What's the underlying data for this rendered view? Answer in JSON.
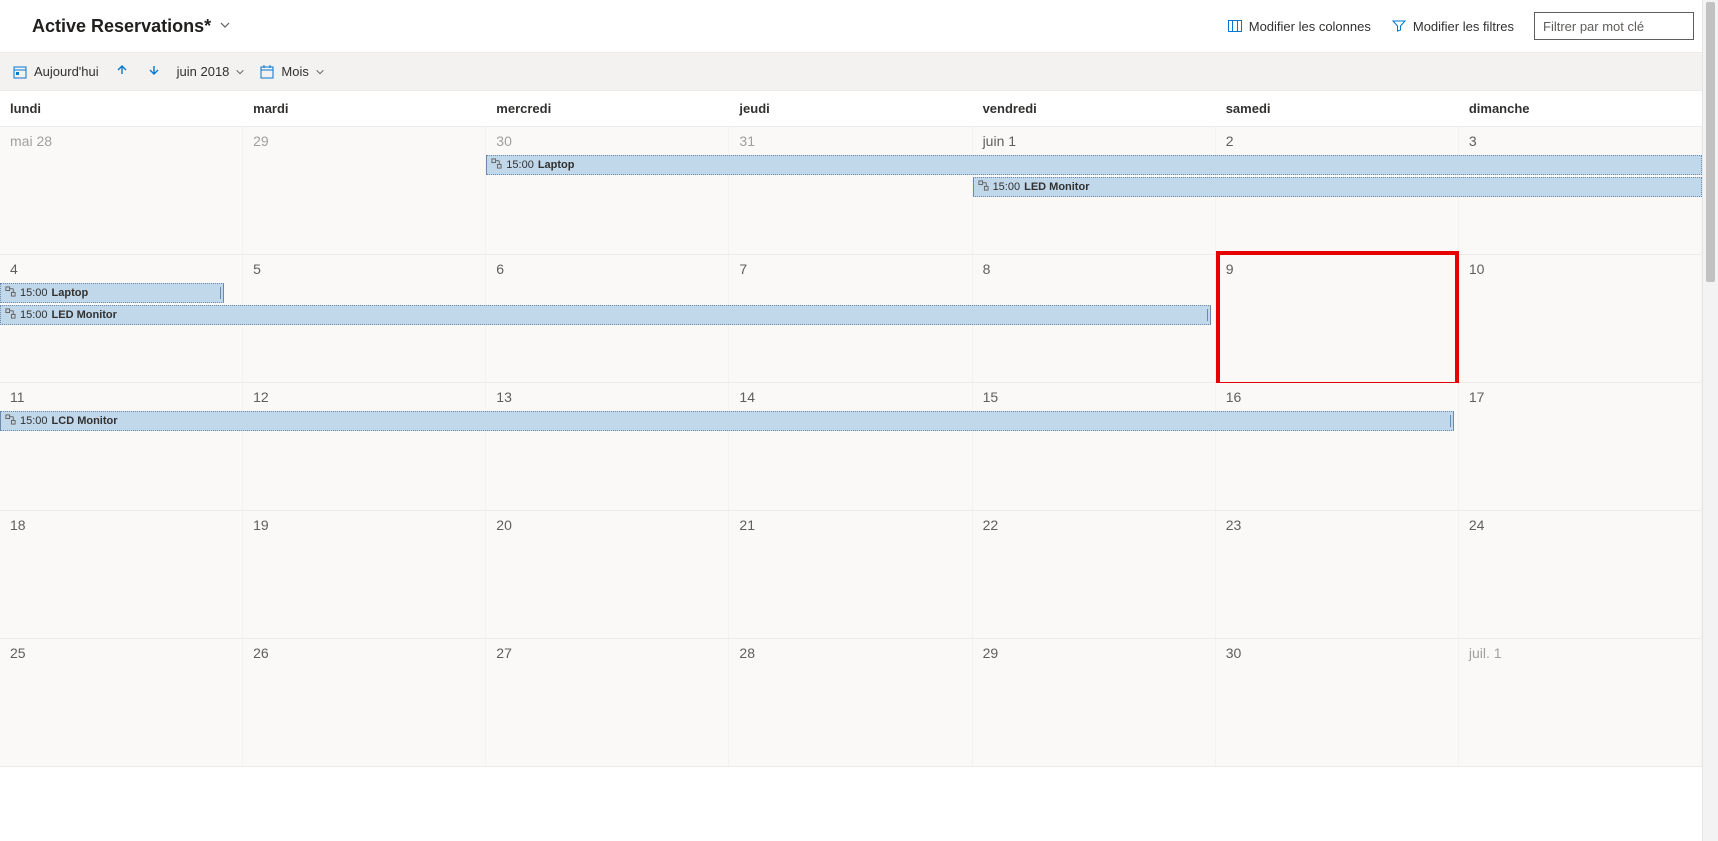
{
  "header": {
    "title": "Active Reservations*",
    "modify_columns": "Modifier les colonnes",
    "modify_filters": "Modifier les filtres",
    "filter_placeholder": "Filtrer par mot clé"
  },
  "toolbar": {
    "today": "Aujourd'hui",
    "date_label": "juin 2018",
    "view_label": "Mois"
  },
  "days": [
    "lundi",
    "mardi",
    "mercredi",
    "jeudi",
    "vendredi",
    "samedi",
    "dimanche"
  ],
  "weeks": [
    {
      "cells": [
        {
          "label": "mai 28",
          "other": true
        },
        {
          "label": "29",
          "other": true
        },
        {
          "label": "30",
          "other": true
        },
        {
          "label": "31",
          "other": true
        },
        {
          "label": "juin 1"
        },
        {
          "label": "2"
        },
        {
          "label": "3"
        }
      ],
      "events": [
        {
          "row": 0,
          "startCol": 2,
          "endCol": 7,
          "time": "15:00",
          "title": "Laptop",
          "startCap": true,
          "endCap": false
        },
        {
          "row": 1,
          "startCol": 4,
          "endCol": 7,
          "time": "15:00",
          "title": "LED Monitor",
          "startCap": true,
          "endCap": false
        }
      ]
    },
    {
      "cells": [
        {
          "label": "4"
        },
        {
          "label": "5"
        },
        {
          "label": "6"
        },
        {
          "label": "7"
        },
        {
          "label": "8"
        },
        {
          "label": "9",
          "highlight": true
        },
        {
          "label": "10"
        }
      ],
      "events": [
        {
          "row": 0,
          "startCol": 0,
          "endCol": 1,
          "time": "15:00",
          "title": "Laptop",
          "startCap": false,
          "endCap": true,
          "endFraction": 0.92
        },
        {
          "row": 1,
          "startCol": 0,
          "endCol": 5,
          "time": "15:00",
          "title": "LED Monitor",
          "startCap": false,
          "endCap": true,
          "endFraction": 0.98
        }
      ]
    },
    {
      "cells": [
        {
          "label": "11"
        },
        {
          "label": "12"
        },
        {
          "label": "13"
        },
        {
          "label": "14"
        },
        {
          "label": "15"
        },
        {
          "label": "16"
        },
        {
          "label": "17"
        }
      ],
      "events": [
        {
          "row": 0,
          "startCol": 0,
          "endCol": 6,
          "time": "15:00",
          "title": "LCD Monitor",
          "startCap": true,
          "endCap": true,
          "endFraction": 0.98
        }
      ]
    },
    {
      "cells": [
        {
          "label": "18"
        },
        {
          "label": "19"
        },
        {
          "label": "20"
        },
        {
          "label": "21"
        },
        {
          "label": "22"
        },
        {
          "label": "23"
        },
        {
          "label": "24"
        }
      ],
      "events": []
    },
    {
      "cells": [
        {
          "label": "25"
        },
        {
          "label": "26"
        },
        {
          "label": "27"
        },
        {
          "label": "28"
        },
        {
          "label": "29"
        },
        {
          "label": "30"
        },
        {
          "label": "juil. 1",
          "other": true
        }
      ],
      "events": []
    }
  ]
}
